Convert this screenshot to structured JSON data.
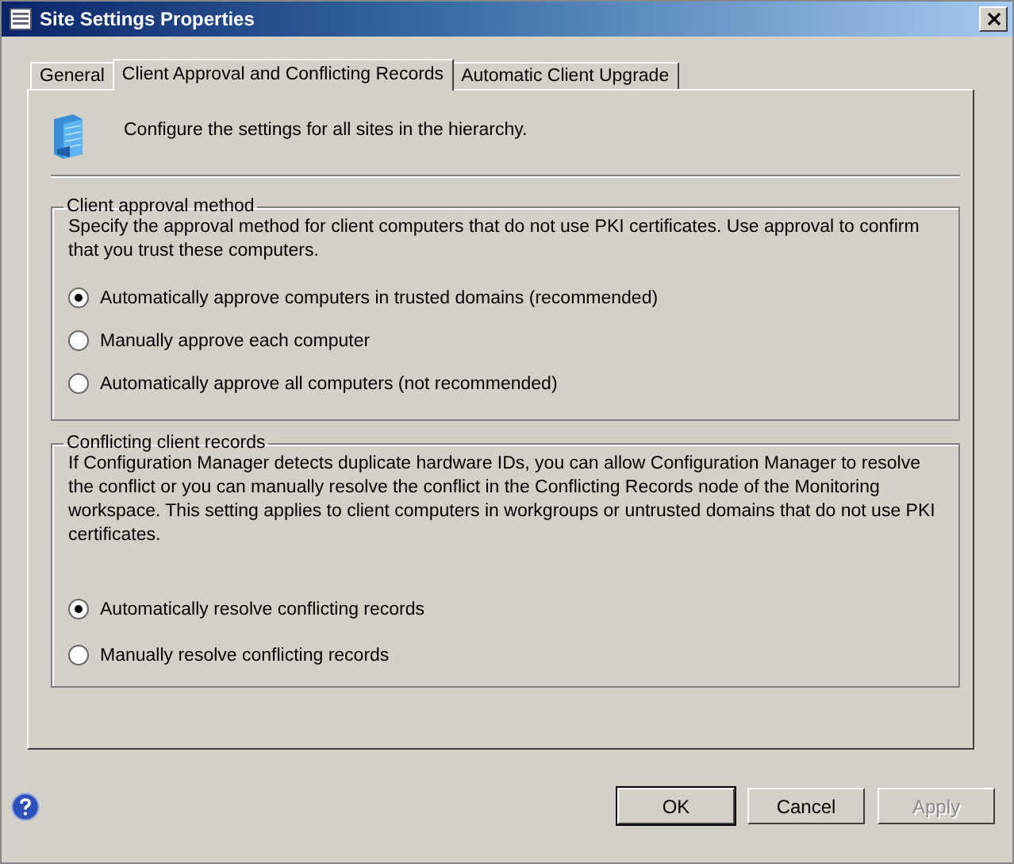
{
  "window": {
    "title": "Site Settings Properties"
  },
  "tabs": [
    {
      "label": "General",
      "selected": false
    },
    {
      "label": "Client Approval and Conflicting Records",
      "selected": true
    },
    {
      "label": "Automatic Client Upgrade",
      "selected": false
    }
  ],
  "header": {
    "text": "Configure the settings for all sites in the hierarchy."
  },
  "groups": [
    {
      "title": "Client approval method",
      "description": "Specify the approval method for client computers that do not use PKI certificates. Use approval to confirm that you trust these computers.",
      "options": [
        {
          "label": "Automatically approve computers in trusted domains (recommended)",
          "selected": true
        },
        {
          "label": "Manually approve each computer",
          "selected": false
        },
        {
          "label": "Automatically approve all computers (not recommended)",
          "selected": false
        }
      ]
    },
    {
      "title": "Conflicting client records",
      "description": "If Configuration Manager detects duplicate hardware IDs, you can allow Configuration Manager to resolve the conflict or you can manually resolve the conflict in the Conflicting Records node of the Monitoring workspace. This setting applies to client computers in workgroups or untrusted domains that do not use PKI certificates.",
      "options": [
        {
          "label": "Automatically resolve conflicting records",
          "selected": true
        },
        {
          "label": "Manually resolve conflicting records",
          "selected": false
        }
      ]
    }
  ],
  "buttons": [
    {
      "label": "OK",
      "kind": "default",
      "disabled": false
    },
    {
      "label": "Cancel",
      "kind": "normal",
      "disabled": false
    },
    {
      "label": "Apply",
      "kind": "normal",
      "disabled": true
    }
  ]
}
